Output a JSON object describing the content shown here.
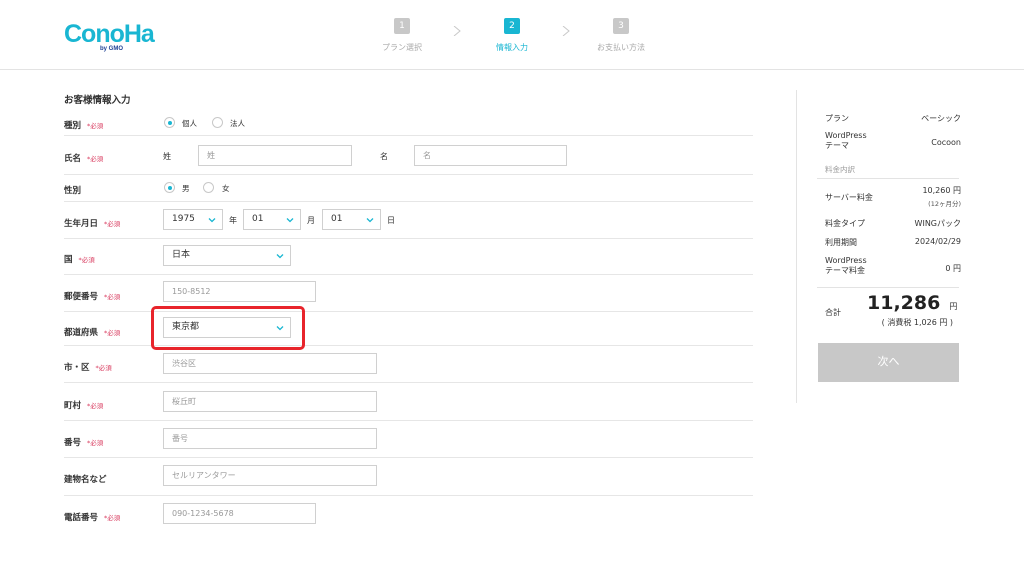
{
  "header": {
    "logo_text": "ConoHa by GMO",
    "steps": [
      {
        "num": "1",
        "label": "プラン選択"
      },
      {
        "num": "2",
        "label": "情報入力"
      },
      {
        "num": "3",
        "label": "お支払い方法"
      }
    ]
  },
  "form": {
    "title": "お客様情報入力",
    "required_mark": "*必須",
    "type": {
      "label": "種別",
      "opt1": "個人",
      "opt2": "法人",
      "selected": "個人"
    },
    "name": {
      "label": "氏名",
      "last_label": "姓",
      "last_placeholder": "姓",
      "first_label": "名",
      "first_placeholder": "名"
    },
    "gender": {
      "label": "性別",
      "opt1": "男",
      "opt2": "女",
      "selected": "男"
    },
    "birth": {
      "label": "生年月日",
      "year": "1975",
      "year_unit": "年",
      "month": "01",
      "month_unit": "月",
      "day": "01",
      "day_unit": "日"
    },
    "country": {
      "label": "国",
      "value": "日本"
    },
    "postal": {
      "label": "郵便番号",
      "placeholder": "150-8512"
    },
    "prefecture": {
      "label": "都道府県",
      "value": "東京都"
    },
    "city": {
      "label": "市・区",
      "placeholder": "渋谷区"
    },
    "town": {
      "label": "町村",
      "placeholder": "桜丘町"
    },
    "number": {
      "label": "番号",
      "placeholder": "番号"
    },
    "building": {
      "label": "建物名など",
      "placeholder": "セルリアンタワー"
    },
    "phone": {
      "label": "電話番号",
      "placeholder": "090-1234-5678"
    }
  },
  "summary": {
    "plan_label": "プラン",
    "plan_value": "ベーシック",
    "theme_label_1": "WordPress",
    "theme_label_2": "テーマ",
    "theme_value": "Cocoon",
    "breakdown_label": "料金内訳",
    "server_fee_label": "サーバー料金",
    "server_fee_value": "10,260 円",
    "server_fee_note": "(12ヶ月分)",
    "fee_type_label": "料金タイプ",
    "fee_type_value": "WINGパック",
    "period_label": "利用期間",
    "period_value": "2024/02/29",
    "theme_fee_label_1": "WordPress",
    "theme_fee_label_2": "テーマ料金",
    "theme_fee_value": "0 円",
    "total_label": "合計",
    "total_value": "11,286",
    "total_unit": "円",
    "tax_note": "( 消費税 1,026 円 )",
    "next_label": "次へ"
  },
  "colors": {
    "accent": "#19b6d2",
    "required": "#d8385c",
    "highlight": "#e8242b",
    "button_disabled": "#c8c8c8"
  }
}
